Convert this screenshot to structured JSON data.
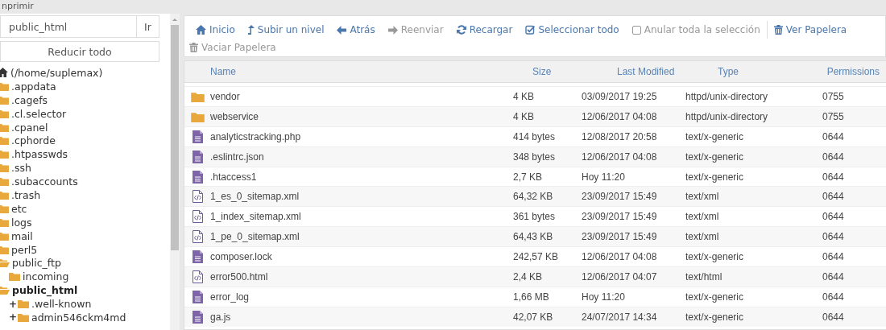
{
  "top_bar": {
    "text": "nprimir"
  },
  "sidebar": {
    "path_field": {
      "value": "public_html"
    },
    "go_button": "Ir",
    "collapse_button": "Reducir todo",
    "tree": [
      {
        "kind": "home",
        "label": "(/home/suplemax)",
        "selected": false,
        "children": [
          {
            "kind": "folder",
            "label": ".appdata",
            "expanded": false,
            "selected": false
          },
          {
            "kind": "folder",
            "label": ".cagefs",
            "expanded": false,
            "selected": false
          },
          {
            "kind": "folder",
            "label": ".cl.selector",
            "expanded": false,
            "selected": false
          },
          {
            "kind": "folder",
            "label": ".cpanel",
            "expanded": false,
            "selected": false
          },
          {
            "kind": "folder",
            "label": ".cphorde",
            "expanded": false,
            "selected": false
          },
          {
            "kind": "folder",
            "label": ".htpasswds",
            "expanded": false,
            "selected": false
          },
          {
            "kind": "folder",
            "label": ".ssh",
            "expanded": false,
            "selected": false
          },
          {
            "kind": "folder",
            "label": ".subaccounts",
            "expanded": false,
            "selected": false
          },
          {
            "kind": "folder",
            "label": ".trash",
            "expanded": false,
            "selected": false
          },
          {
            "kind": "folder",
            "label": "etc",
            "expanded": false,
            "selected": false
          },
          {
            "kind": "folder",
            "label": "logs",
            "expanded": false,
            "selected": false
          },
          {
            "kind": "folder",
            "label": "mail",
            "expanded": false,
            "selected": false
          },
          {
            "kind": "folder",
            "label": "perl5",
            "expanded": false,
            "selected": false
          },
          {
            "kind": "folder",
            "label": "public_ftp",
            "expanded": true,
            "selected": false,
            "children": [
              {
                "kind": "folder",
                "label": "incoming",
                "expanded": false,
                "selected": false
              }
            ]
          },
          {
            "kind": "folder",
            "label": "public_html",
            "expanded": true,
            "selected": true,
            "children": [
              {
                "kind": "folder",
                "label": ".well-known",
                "toggle": "+",
                "expanded": false,
                "selected": false
              },
              {
                "kind": "folder",
                "label": "admin546ckm4md",
                "toggle": "+",
                "expanded": false,
                "selected": false
              }
            ]
          }
        ]
      }
    ]
  },
  "toolbar": [
    {
      "kind": "home",
      "label": "Inicio",
      "disabled": false
    },
    {
      "kind": "up",
      "label": "Subir un nivel",
      "disabled": false
    },
    {
      "kind": "back",
      "label": "Atrás",
      "disabled": false
    },
    {
      "kind": "forward",
      "label": "Reenviar",
      "disabled": true
    },
    {
      "kind": "reload",
      "label": "Recargar",
      "disabled": false
    },
    {
      "kind": "select-all",
      "label": "Seleccionar todo",
      "disabled": false
    },
    {
      "kind": "deselect",
      "label": "Anular toda la selección",
      "disabled": true
    },
    {
      "kind": "trash",
      "label": "Ver Papelera",
      "disabled": false
    },
    {
      "kind": "trash",
      "label": "Vaciar Papelera",
      "disabled": true
    }
  ],
  "table": {
    "columns": [
      "Name",
      "Size",
      "Last Modified",
      "Type",
      "Permissions"
    ],
    "rows": [
      {
        "kind": "folder",
        "name": "vendor",
        "size": "4 KB",
        "modified": "03/09/2017 19:25",
        "type": "httpd/unix-directory",
        "permissions": "0755"
      },
      {
        "kind": "folder",
        "name": "webservice",
        "size": "4 KB",
        "modified": "12/06/2017 04:08",
        "type": "httpd/unix-directory",
        "permissions": "0755"
      },
      {
        "kind": "file",
        "name": "analyticstracking.php",
        "size": "414 bytes",
        "modified": "12/08/2017 20:58",
        "type": "text/x-generic",
        "permissions": "0644"
      },
      {
        "kind": "file",
        "name": ".eslintrc.json",
        "size": "348 bytes",
        "modified": "12/06/2017 04:08",
        "type": "text/x-generic",
        "permissions": "0644"
      },
      {
        "kind": "file",
        "name": ".htaccess1",
        "size": "2,7 KB",
        "modified": "Hoy 11:20",
        "type": "text/x-generic",
        "permissions": "0644"
      },
      {
        "kind": "code",
        "name": "1_es_0_sitemap.xml",
        "size": "64,32 KB",
        "modified": "23/09/2017 15:49",
        "type": "text/xml",
        "permissions": "0644"
      },
      {
        "kind": "code",
        "name": "1_index_sitemap.xml",
        "size": "361 bytes",
        "modified": "23/09/2017 15:49",
        "type": "text/xml",
        "permissions": "0644"
      },
      {
        "kind": "code",
        "name": "1_pe_0_sitemap.xml",
        "size": "64,43 KB",
        "modified": "23/09/2017 15:49",
        "type": "text/xml",
        "permissions": "0644"
      },
      {
        "kind": "file",
        "name": "composer.lock",
        "size": "242,57 KB",
        "modified": "12/06/2017 04:08",
        "type": "text/x-generic",
        "permissions": "0644"
      },
      {
        "kind": "code",
        "name": "error500.html",
        "size": "2,4 KB",
        "modified": "12/06/2017 04:07",
        "type": "text/html",
        "permissions": "0644"
      },
      {
        "kind": "file",
        "name": "error_log",
        "size": "1,66 MB",
        "modified": "Hoy 11:20",
        "type": "text/x-generic",
        "permissions": "0644"
      },
      {
        "kind": "file",
        "name": "ga.js",
        "size": "42,07 KB",
        "modified": "24/07/2017 14:34",
        "type": "text/x-generic",
        "permissions": "0644"
      }
    ]
  }
}
